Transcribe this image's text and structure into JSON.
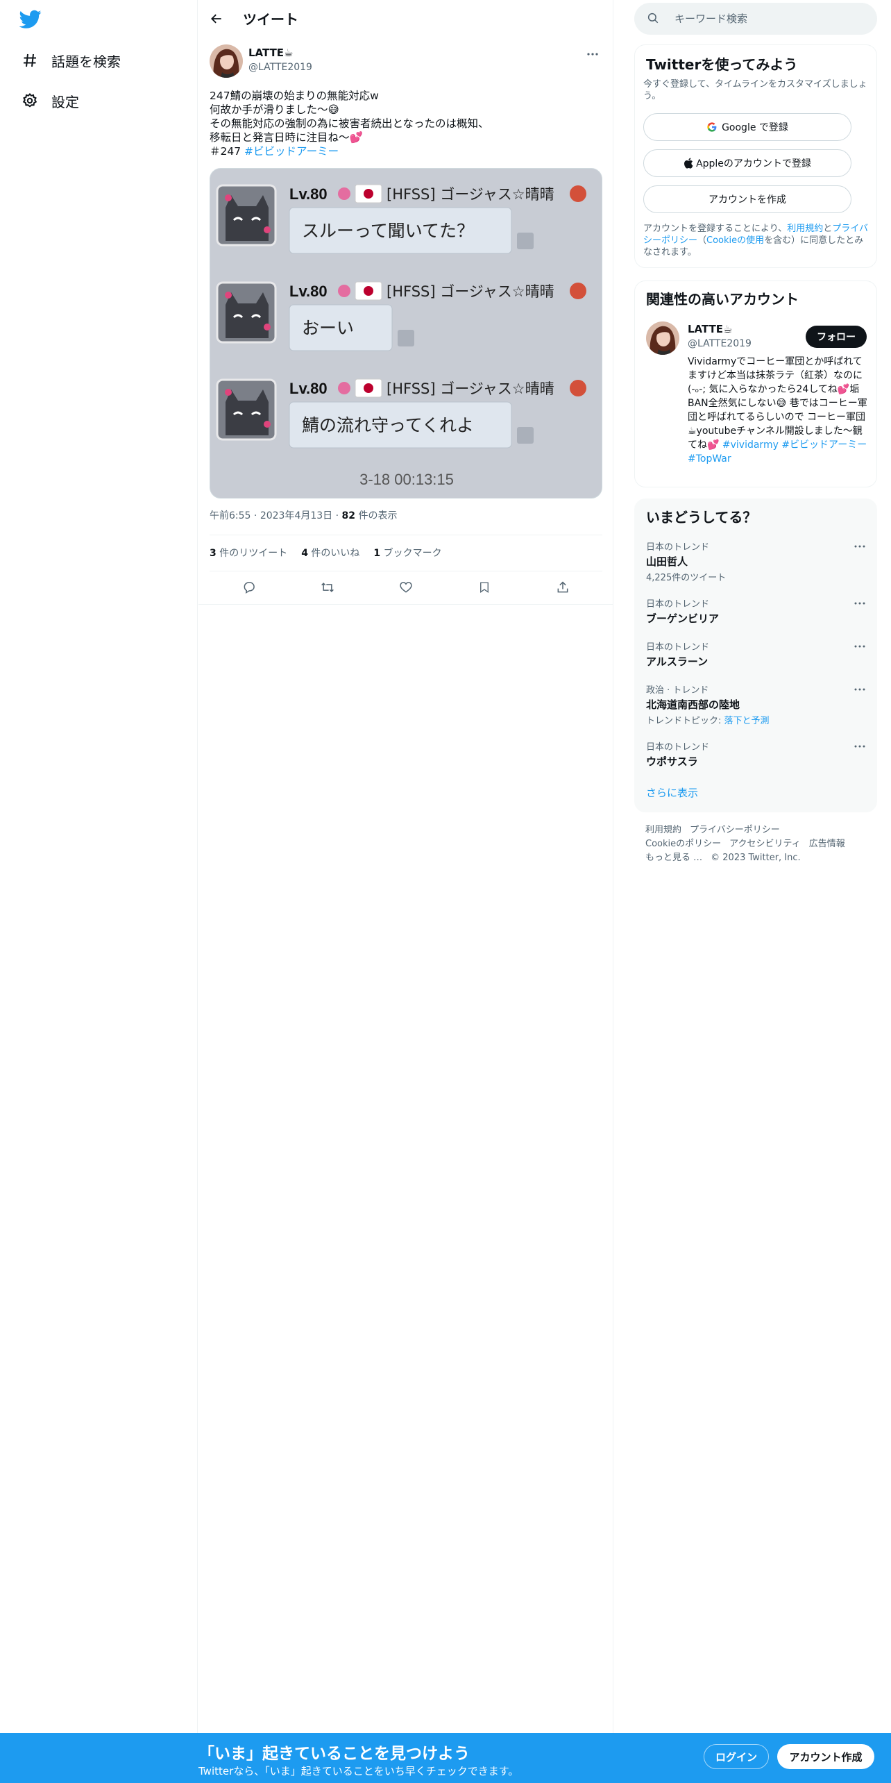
{
  "nav": {
    "items": [
      {
        "label": "話題を検索",
        "icon": "hashtag-icon"
      },
      {
        "label": "設定",
        "icon": "gear-icon"
      }
    ]
  },
  "header": {
    "title": "ツイート"
  },
  "tweet": {
    "author_name": "LATTE☕",
    "author_handle": "@LATTE2019",
    "lines": [
      "247鯖の崩壊の始まりの無能対応w",
      "何故か手が滑りました〜😅",
      "その無能対応の強制の為に被害者続出となったのは概知、",
      "移転日と発言日時に注目ね〜💕",
      "＃247 "
    ],
    "hashtag": "#ビビッドアーミー",
    "media": {
      "messages": [
        {
          "level": "Lv.80",
          "user": "[HFSS] ゴージャス☆晴晴",
          "text": "スルーって聞いてた？"
        },
        {
          "level": "Lv.80",
          "user": "[HFSS] ゴージャス☆晴晴",
          "text": "おーい"
        },
        {
          "level": "Lv.80",
          "user": "[HFSS] ゴージャス☆晴晴",
          "text": "鯖の流れ守ってくれよ"
        }
      ],
      "timestamp": "3-18 00:13:15"
    },
    "time": "午前6:55",
    "date": "2023年4月13日",
    "views_count": "82",
    "views_label": " 件の表示",
    "retweets_count": "3",
    "retweets_label": " 件のリツイート",
    "likes_count": "4",
    "likes_label": " 件のいいね",
    "bookmarks_count": "1",
    "bookmarks_label": " ブックマーク"
  },
  "search": {
    "placeholder": "キーワード検索"
  },
  "signup": {
    "title": "Twitterを使ってみよう",
    "subtitle": "今すぐ登録して、タイムラインをカスタマイズしましょう。",
    "google_label": "Google で登録",
    "apple_label": "Appleのアカウントで登録",
    "create_label": "アカウントを作成",
    "legal_prefix": "アカウントを登録することにより、",
    "legal_terms": "利用規約",
    "legal_and": "と",
    "legal_privacy": "プライバシーポリシー",
    "legal_open": "（",
    "legal_cookie": "Cookieの使用",
    "legal_suffix": "を含む）に同意したとみなされます。"
  },
  "related": {
    "title": "関連性の高いアカウント",
    "name": "LATTE☕",
    "handle": "@LATTE2019",
    "follow_label": "フォロー",
    "bio": "Vividarmyでコーヒー軍団とか呼ばれてますけど本当は抹茶ラテ（紅茶）なのに(-ₒ-; 気に入らなかったら24してね💕垢BAN全然気にしない😅 巷ではコーヒー軍団と呼ばれてるらしいので コーヒー軍団☕youtubeチャンネル開設しました〜観てね💕 ",
    "bio_tags": [
      "#vividarmy",
      "#ビビッドアーミー",
      "#TopWar"
    ]
  },
  "trends": {
    "title": "いまどうしてる？",
    "items": [
      {
        "context": "日本のトレンド",
        "name": "山田哲人",
        "extra": "4,225件のツイート"
      },
      {
        "context": "日本のトレンド",
        "name": "ブーゲンビリア",
        "extra": ""
      },
      {
        "context": "日本のトレンド",
        "name": "アルスラーン",
        "extra": ""
      },
      {
        "context": "政治 · トレンド",
        "name": "北海道南西部の陸地",
        "extra_prefix": "トレンドトピック: ",
        "extra_link": "落下と予測"
      },
      {
        "context": "日本のトレンド",
        "name": "ウポサスラ",
        "extra": ""
      }
    ],
    "show_more": "さらに表示"
  },
  "footer": {
    "links": [
      "利用規約",
      "プライバシーポリシー",
      "Cookieのポリシー",
      "アクセシビリティ",
      "広告情報",
      "もっと見る …"
    ],
    "copyright": "© 2023 Twitter, Inc."
  },
  "bottombar": {
    "title": "「いま」起きていることを見つけよう",
    "subtitle": "Twitterなら、「いま」起きていることをいち早くチェックできます。",
    "login_label": "ログイン",
    "signup_label": "アカウント作成"
  },
  "colors": {
    "accent": "#1d9bf0",
    "text": "#0f1419",
    "muted": "#536471"
  }
}
